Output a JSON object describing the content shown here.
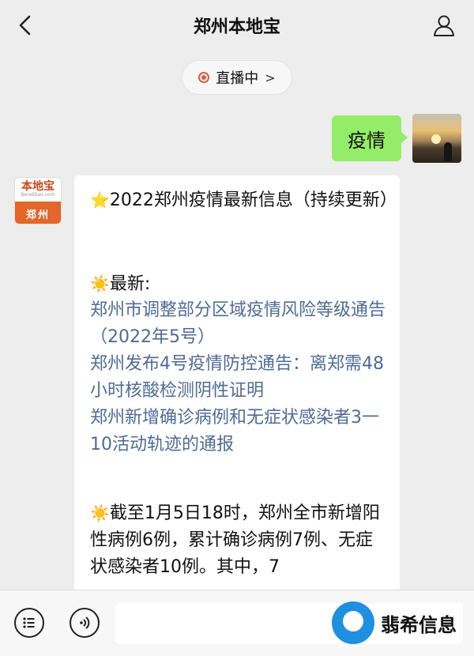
{
  "header": {
    "title": "郑州本地宝",
    "back_icon": "chevron-left-icon",
    "profile_icon": "person-icon"
  },
  "live": {
    "label": "直播中",
    "chevron": ">",
    "dot_color": "#e05a3c"
  },
  "user_message": {
    "text": "疫情",
    "bubble_color": "#95ec69"
  },
  "bot": {
    "avatar_brand": "本地宝",
    "avatar_site": "Bendibao.com",
    "avatar_city": "郑州",
    "title": "2022郑州疫情最新信息（持续更新）",
    "latest_label": "最新:",
    "links": [
      "郑州市调整部分区域疫情风险等级通告（2022年5号）",
      "郑州发布4号疫情防控通告：离郑需48小时核酸检测阴性证明",
      "郑州新增确诊病例和无症状感染者3一10活动轨迹的通报"
    ],
    "summary": "截至1月5日18时，郑州全市新增阳性病例6例，累计确诊病例7例、无症状感染者10例。其中，7",
    "link_color": "#4f6b95"
  },
  "bottom": {
    "menu_icon": "menu-list-icon",
    "voice_icon": "voice-icon",
    "input_placeholder": ""
  },
  "watermark": {
    "text": "翡希信息"
  }
}
